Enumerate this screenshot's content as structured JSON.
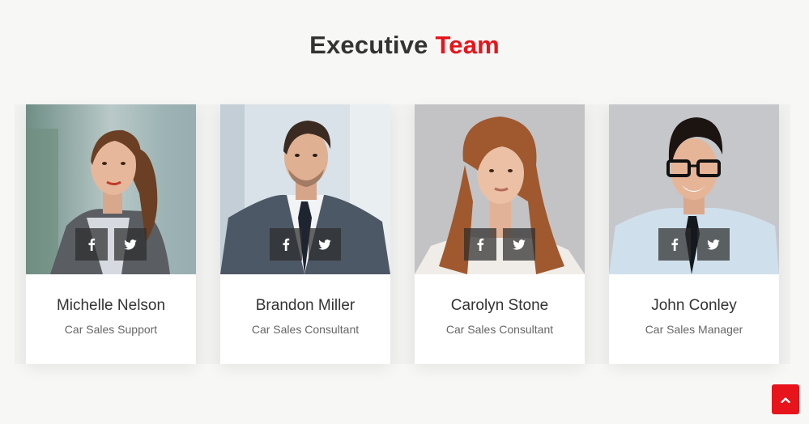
{
  "section": {
    "title_main": "Executive",
    "title_accent": "Team"
  },
  "colors": {
    "accent": "#e8141b",
    "text": "#333333",
    "muted": "#666666"
  },
  "team": [
    {
      "name": "Michelle Nelson",
      "role": "Car Sales Support",
      "socials": [
        "facebook-icon",
        "twitter-icon"
      ]
    },
    {
      "name": "Brandon Miller",
      "role": "Car Sales Consultant",
      "socials": [
        "facebook-icon",
        "twitter-icon"
      ]
    },
    {
      "name": "Carolyn Stone",
      "role": "Car Sales Consultant",
      "socials": [
        "facebook-icon",
        "twitter-icon"
      ]
    },
    {
      "name": "John Conley",
      "role": "Car Sales Manager",
      "socials": [
        "facebook-icon",
        "twitter-icon"
      ]
    }
  ],
  "back_to_top": {
    "icon": "chevron-up-icon"
  }
}
